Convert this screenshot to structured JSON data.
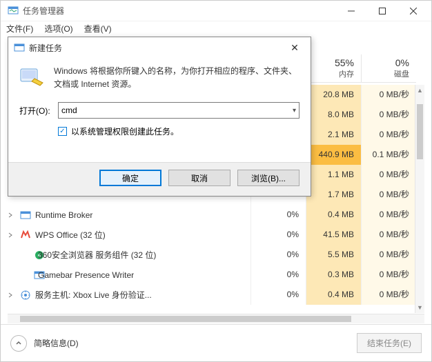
{
  "titlebar": {
    "title": "任务管理器"
  },
  "menu": {
    "file": "文件(F)",
    "options": "选项(O)",
    "view": "查看(V)"
  },
  "columns": {
    "mem_pct": "55%",
    "mem_label": "内存",
    "disk_pct": "0%",
    "disk_label": "磁盘"
  },
  "rows": [
    {
      "name": "",
      "cpu": "",
      "mem": "20.8 MB",
      "disk": "0 MB/秒",
      "hot": false
    },
    {
      "name": "",
      "cpu": "",
      "mem": "8.0 MB",
      "disk": "0 MB/秒",
      "hot": false
    },
    {
      "name": "",
      "cpu": "",
      "mem": "2.1 MB",
      "disk": "0 MB/秒",
      "hot": false
    },
    {
      "name": "",
      "cpu": "",
      "mem": "440.9 MB",
      "disk": "0.1 MB/秒",
      "hot": true
    },
    {
      "name": "",
      "cpu": "",
      "mem": "1.1 MB",
      "disk": "0 MB/秒",
      "hot": false
    },
    {
      "name": "",
      "cpu": "",
      "mem": "1.7 MB",
      "disk": "0 MB/秒",
      "hot": false
    },
    {
      "name": "Runtime Broker",
      "cpu": "0%",
      "mem": "0.4 MB",
      "disk": "0 MB/秒",
      "hot": false,
      "expand": true,
      "icon": "app"
    },
    {
      "name": "WPS Office (32 位)",
      "cpu": "0%",
      "mem": "41.5 MB",
      "disk": "0 MB/秒",
      "hot": false,
      "expand": true,
      "icon": "wps"
    },
    {
      "name": "360安全浏览器 服务组件 (32 位)",
      "cpu": "0%",
      "mem": "5.5 MB",
      "disk": "0 MB/秒",
      "hot": false,
      "expand": false,
      "indent": true,
      "icon": "360"
    },
    {
      "name": "Gamebar Presence Writer",
      "cpu": "0%",
      "mem": "0.3 MB",
      "disk": "0 MB/秒",
      "hot": false,
      "expand": false,
      "indent": true,
      "icon": "app"
    },
    {
      "name": "服务主机: Xbox Live 身份验证...",
      "cpu": "0%",
      "mem": "0.4 MB",
      "disk": "0 MB/秒",
      "hot": false,
      "expand": true,
      "icon": "svc"
    }
  ],
  "footer": {
    "brief": "简略信息(D)",
    "end_task": "结束任务(E)"
  },
  "dialog": {
    "title": "新建任务",
    "desc": "Windows 将根据你所键入的名称，为你打开相应的程序、文件夹、文档或 Internet 资源。",
    "open_label": "打开(O):",
    "open_value": "cmd",
    "admin_check": "以系统管理权限创建此任务。",
    "ok": "确定",
    "cancel": "取消",
    "browse": "浏览(B)..."
  }
}
